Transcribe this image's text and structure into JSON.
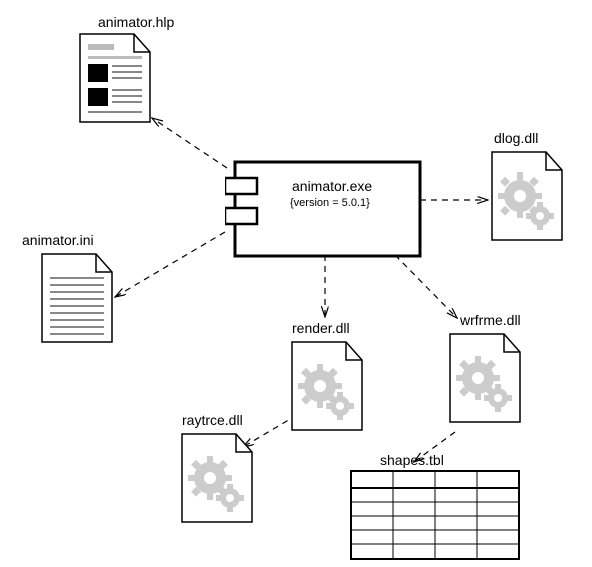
{
  "component": {
    "name": "animator.exe",
    "version_tag": "{version = 5.0.1}"
  },
  "artifacts": {
    "help": {
      "label": "animator.hlp"
    },
    "ini": {
      "label": "animator.ini"
    },
    "dlog": {
      "label": "dlog.dll"
    },
    "render": {
      "label": "render.dll"
    },
    "wrfrme": {
      "label": "wrfrme.dll"
    },
    "raytrce": {
      "label": "raytrce.dll"
    },
    "shapes": {
      "label": "shapes.tbl"
    }
  }
}
